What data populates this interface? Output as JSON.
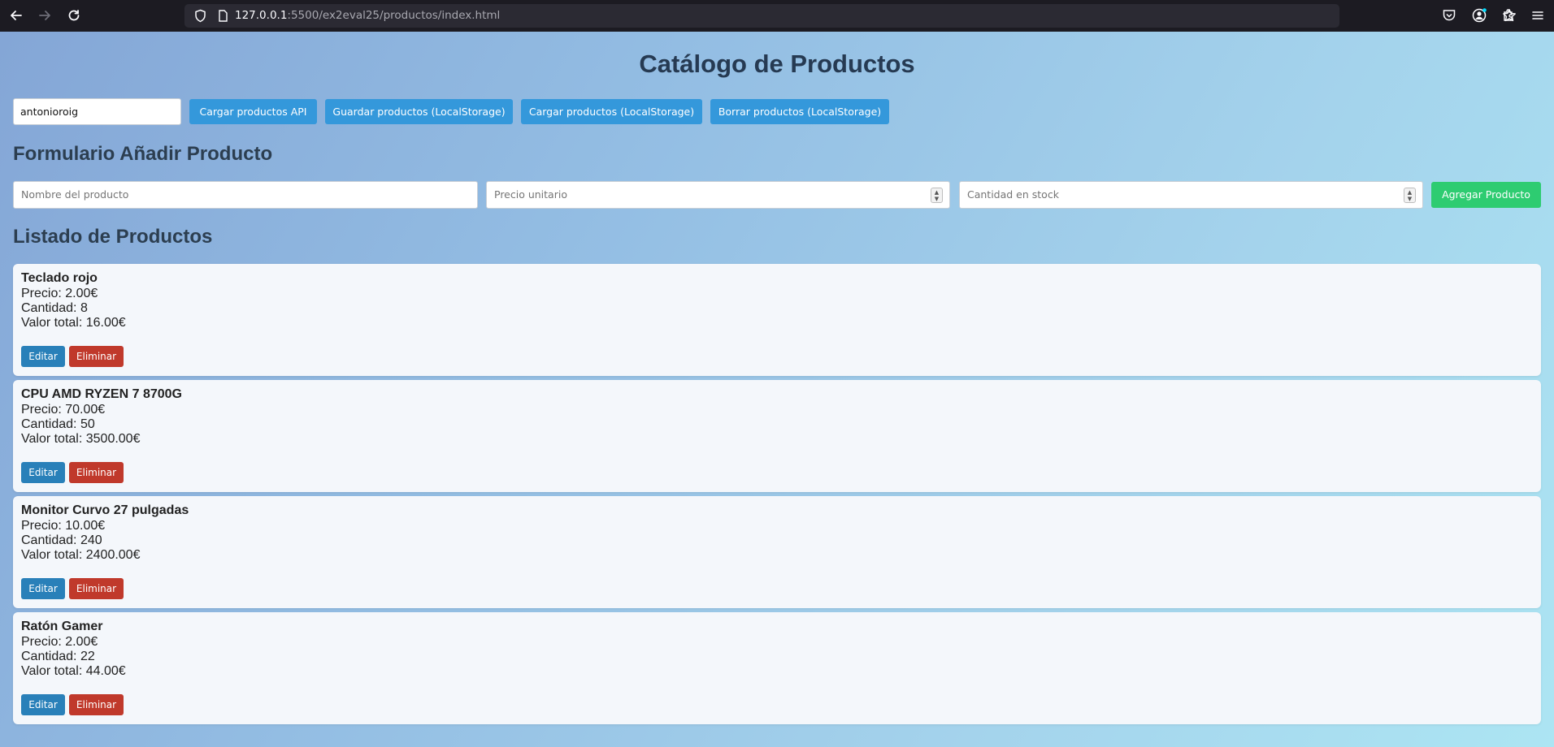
{
  "browser": {
    "url_host": "127.0.0.1",
    "url_rest": ":5500/ex2eval25/productos/index.html",
    "icons": [
      "back-arrow-icon",
      "forward-arrow-icon",
      "reload-icon",
      "shield-icon",
      "page-icon",
      "star-icon",
      "pocket-icon",
      "account-icon",
      "extensions-icon",
      "menu-icon"
    ]
  },
  "page": {
    "title": "Catálogo de Productos"
  },
  "toolbar": {
    "user_value": "antonioroig",
    "load_api_label": "Cargar productos API",
    "save_local_label": "Guardar productos (LocalStorage)",
    "load_local_label": "Cargar productos (LocalStorage)",
    "delete_local_label": "Borrar productos (LocalStorage)"
  },
  "form": {
    "title": "Formulario Añadir Producto",
    "name_placeholder": "Nombre del producto",
    "price_placeholder": "Precio unitario",
    "stock_placeholder": "Cantidad en stock",
    "add_label": "Agregar Producto"
  },
  "list": {
    "title": "Listado de Productos",
    "edit_label": "Editar",
    "delete_label": "Eliminar",
    "products": [
      {
        "name": "Teclado rojo",
        "price": "Precio: 2.00€",
        "qty": "Cantidad: 8",
        "total": "Valor total: 16.00€"
      },
      {
        "name": "CPU AMD RYZEN 7 8700G",
        "price": "Precio: 70.00€",
        "qty": "Cantidad: 50",
        "total": "Valor total: 3500.00€"
      },
      {
        "name": "Monitor Curvo 27 pulgadas",
        "price": "Precio: 10.00€",
        "qty": "Cantidad: 240",
        "total": "Valor total: 2400.00€"
      },
      {
        "name": "Ratón Gamer",
        "price": "Precio: 2.00€",
        "qty": "Cantidad: 22",
        "total": "Valor total: 44.00€"
      }
    ]
  },
  "colors": {
    "primary_button": "#3498db",
    "add_button": "#2ecc71",
    "edit_button": "#2980b9",
    "delete_button": "#c0392b",
    "heading": "#2c3e50"
  }
}
